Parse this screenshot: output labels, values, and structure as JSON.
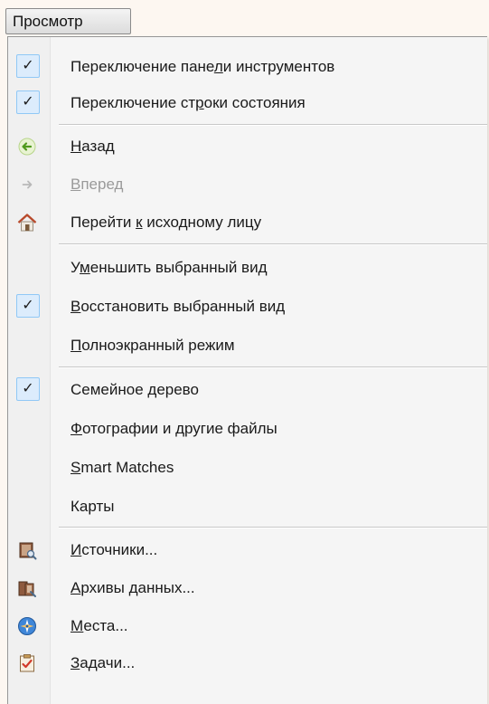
{
  "menubar": {
    "label": "Просмотр"
  },
  "menu": {
    "items": [
      {
        "pre": "Переключение пане",
        "u": "л",
        "post": "и инструментов",
        "checked": true,
        "icon": ""
      },
      {
        "pre": "Переключение ст",
        "u": "р",
        "post": "оки состояния",
        "checked": true,
        "icon": ""
      },
      {
        "pre": "",
        "u": "Н",
        "post": "азад",
        "checked": false,
        "icon": "back-arrow-icon"
      },
      {
        "pre": "",
        "u": "В",
        "post": "перед",
        "checked": false,
        "icon": "forward-arrow-icon",
        "disabled": true
      },
      {
        "pre": "Перейти ",
        "u": "к",
        "post": " исходному лицу",
        "checked": false,
        "icon": "home-icon"
      },
      {
        "pre": "У",
        "u": "м",
        "post": "еньшить выбранный вид",
        "checked": false,
        "icon": ""
      },
      {
        "pre": "",
        "u": "В",
        "post": "осстановить выбранный вид",
        "checked": true,
        "icon": ""
      },
      {
        "pre": "",
        "u": "П",
        "post": "олноэкранный режим",
        "checked": false,
        "icon": ""
      },
      {
        "pre": "Семейное ",
        "u": "д",
        "post": "ерево",
        "checked": true,
        "icon": ""
      },
      {
        "pre": "",
        "u": "Ф",
        "post": "отографии и другие файлы",
        "checked": false,
        "icon": ""
      },
      {
        "pre": "",
        "u": "S",
        "post": "mart Matches",
        "checked": false,
        "icon": ""
      },
      {
        "pre": "Карты",
        "u": "",
        "post": "",
        "checked": false,
        "icon": ""
      },
      {
        "pre": "",
        "u": "И",
        "post": "сточники...",
        "checked": false,
        "icon": "sources-icon"
      },
      {
        "pre": "",
        "u": "А",
        "post": "рхивы данных...",
        "checked": false,
        "icon": "repositories-icon"
      },
      {
        "pre": "",
        "u": "М",
        "post": "еста...",
        "checked": false,
        "icon": "places-icon"
      },
      {
        "pre": "",
        "u": "З",
        "post": "адачи...",
        "checked": false,
        "icon": "tasks-icon"
      }
    ],
    "check_glyph": "✓",
    "colors": {
      "check_border": "#90c8f6",
      "check_fill": "#dcecfc",
      "disabled_text": "#9a9a9a"
    }
  }
}
